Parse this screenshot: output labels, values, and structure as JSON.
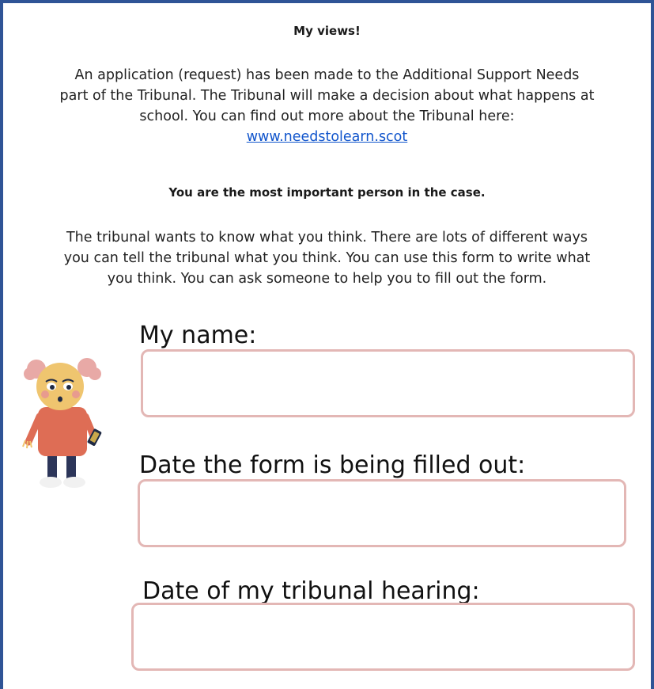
{
  "heading": "My views!",
  "intro": {
    "line1": "An application (request) has been made to the Additional Support Needs",
    "line2": "part of the Tribunal.  The Tribunal will make a decision about what happens at",
    "line3": "school. You can find out more about the Tribunal here:",
    "link": "www.needstolearn.scot"
  },
  "important": "You are the most important person in the case.",
  "explanation": {
    "line1": "The tribunal wants to know what you think.  There are lots of different ways",
    "line2": "you can tell the tribunal what you think.  You can use this form to write what",
    "line3": "you think.  You can ask someone to help you to fill out the form."
  },
  "form": {
    "name_label": "My name:",
    "date_label": "Date the form is being filled out:",
    "hearing_label": "Date of my tribunal hearing:",
    "name_value": "",
    "date_value": "",
    "hearing_value": ""
  },
  "colors": {
    "border": "#2f5496",
    "field_border": "#e3b7b5",
    "link": "#1155cc"
  },
  "illustration": "child-with-phone-illustration"
}
